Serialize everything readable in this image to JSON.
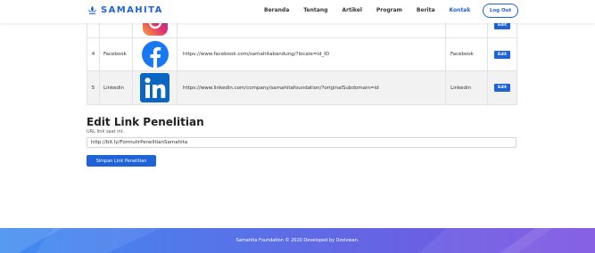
{
  "navbar": {
    "brand": "SAMAHITA",
    "links": [
      {
        "label": "Beranda"
      },
      {
        "label": "Tentang"
      },
      {
        "label": "Artikel"
      },
      {
        "label": "Program"
      },
      {
        "label": "Berita"
      },
      {
        "label": "Kontak"
      }
    ],
    "active_link": "Kontak",
    "logout_label": "Log Out"
  },
  "social_table": {
    "rows": [
      {
        "no": "",
        "name": "",
        "icon": "instagram-icon",
        "url": "",
        "platform": "",
        "action": "Edit"
      },
      {
        "no": "4",
        "name": "Facebook",
        "icon": "facebook-icon",
        "url": "https://www.facebook.com/samahitabandung/?locale=id_ID",
        "platform": "Facebook",
        "action": "Edit"
      },
      {
        "no": "5",
        "name": "Linkedin",
        "icon": "linkedin-icon",
        "url": "https://www.linkedin.com/company/samahitafoundation/?originalSubdomain=id",
        "platform": "Linkedin",
        "action": "Edit"
      }
    ]
  },
  "research_form": {
    "title": "Edit Link Penelitian",
    "label": "URL link saat ini:",
    "value": "http://bit.ly/FormulirPenelitianSamahita",
    "submit_label": "Simpan Link Penelitian"
  },
  "footer": {
    "text": "Samahita Foundation © 2020 Developed by Dzolvwan."
  },
  "colors": {
    "primary": "#1e63d8",
    "facebook": "#1877f2",
    "linkedin": "#0a66c2",
    "instagram": "#e1306c"
  }
}
